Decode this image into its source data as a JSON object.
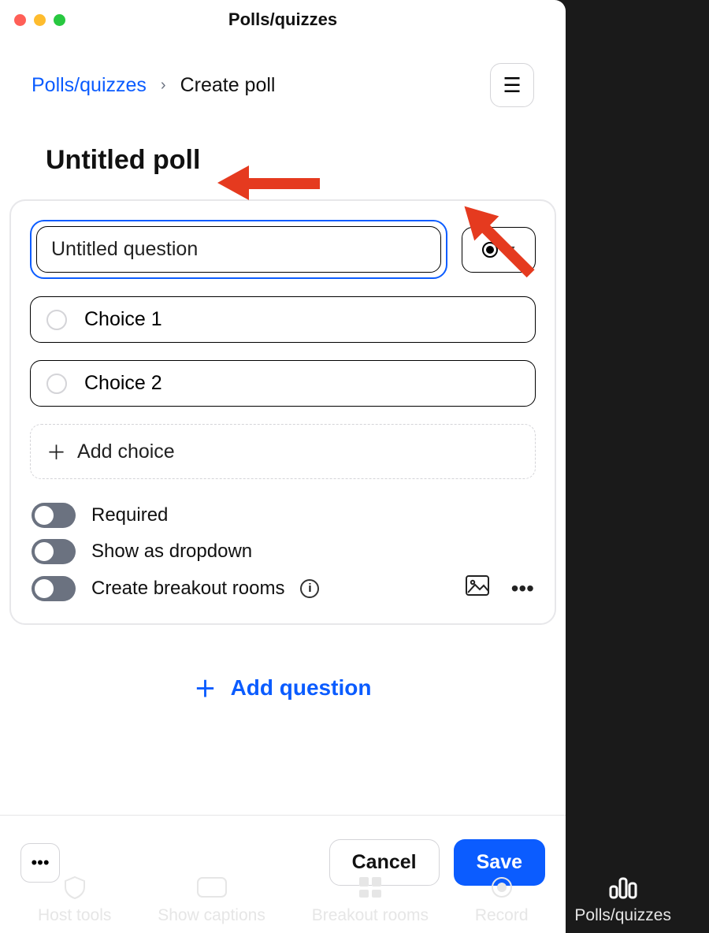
{
  "window": {
    "title": "Polls/quizzes"
  },
  "breadcrumb": {
    "root_label": "Polls/quizzes",
    "current_label": "Create poll"
  },
  "poll": {
    "title": "Untitled poll"
  },
  "question": {
    "text_value": "Untitled question",
    "choices": [
      "Choice 1",
      "Choice 2"
    ],
    "add_choice_label": "Add choice",
    "toggles": {
      "required": "Required",
      "show_as_dropdown": "Show as dropdown",
      "create_breakout_rooms": "Create breakout rooms"
    }
  },
  "add_question_label": "Add question",
  "footer": {
    "cancel_label": "Cancel",
    "save_label": "Save"
  },
  "bottom_bar": {
    "items": [
      "Host tools",
      "Show captions",
      "Breakout rooms",
      "Record",
      "Polls/quizzes"
    ]
  }
}
